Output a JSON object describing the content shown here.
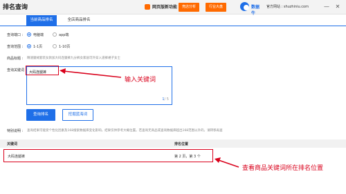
{
  "header": {
    "title": "排名查询",
    "promo_text": "网页版新功能",
    "buttons": [
      "竞店分析",
      "行业大盘"
    ],
    "logo_text": "数据牛",
    "site": "官方网站 : shuzhiniu.com",
    "window_controls": [
      "—",
      "✕"
    ]
  },
  "tabs": [
    {
      "label": "当前商品排名",
      "active": true
    },
    {
      "label": "全店商品排名",
      "active": false
    }
  ],
  "form": {
    "port": {
      "label": "查询端口 :",
      "options": [
        "电脑端",
        "app端"
      ],
      "selected": "电脑端"
    },
    "range": {
      "label": "查询范围 :",
      "options": [
        "1-1页",
        "1-10页"
      ],
      "selected": "1-1页"
    },
    "product_title": {
      "label": "商品标题 :",
      "value": "精速腿绒套装女款加大码连腿裤九分裤女家居可外穿入道裤裙子女士"
    },
    "keywords": {
      "label": "查询关键词 :",
      "value": "大码连腿裤",
      "counter_current": "1",
      "counter_total": "/ 5"
    },
    "query_button": "查询排名",
    "recommend_button": "挖掘蓝海词"
  },
  "notice": {
    "label": "特别说明 :",
    "text": "查询结果可能受个性化因素及168搜索数据库变化影响，结果仅供参考大概位置。若查询无商品或查询数据库超出168范围以外的，请转移再查"
  },
  "table": {
    "headers": [
      "关键词",
      "排名位置"
    ],
    "rows": [
      {
        "keyword": "大码连腿裤",
        "rank": "第 2 页，第 3 个"
      }
    ]
  },
  "annotations": {
    "input_hint": "输入关键词",
    "result_hint": "查看商品关键词所在排名位置"
  },
  "colors": {
    "primary": "#1f6fe8",
    "accent": "#ff6a00",
    "highlight": "#d9001b"
  }
}
